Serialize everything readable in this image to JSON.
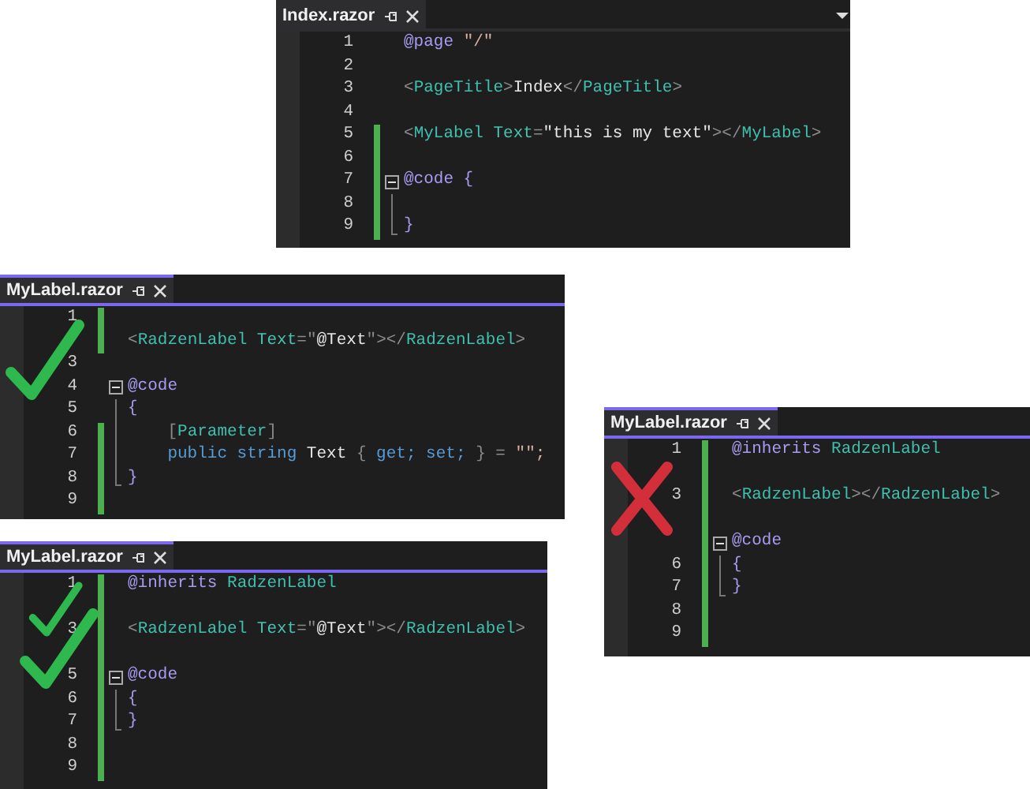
{
  "panels": [
    {
      "tab": {
        "title": "Index.razor",
        "selected": false
      },
      "dropdown": true,
      "lines": [
        {
          "number": "1",
          "changed": false,
          "tokens": [
            {
              "text": "@page",
              "kind": "directive"
            },
            {
              "text": " \"/\"",
              "kind": "string"
            }
          ]
        },
        {
          "number": "2",
          "changed": false
        },
        {
          "number": "3",
          "changed": false,
          "tokens": [
            {
              "text": "<",
              "kind": "punct"
            },
            {
              "text": "PageTitle",
              "kind": "tag"
            },
            {
              "text": ">",
              "kind": "punct"
            },
            {
              "text": "Index",
              "kind": "plain"
            },
            {
              "text": "</",
              "kind": "punct"
            },
            {
              "text": "PageTitle",
              "kind": "tag"
            },
            {
              "text": ">",
              "kind": "punct"
            }
          ]
        },
        {
          "number": "4",
          "changed": false
        },
        {
          "number": "5",
          "changed": true,
          "tokens": [
            {
              "text": "<",
              "kind": "punct"
            },
            {
              "text": "MyLabel",
              "kind": "tag"
            },
            {
              "text": " Text",
              "kind": "attr"
            },
            {
              "text": "=",
              "kind": "punct"
            },
            {
              "text": "\"this is my text\"",
              "kind": "plain"
            },
            {
              "text": "></",
              "kind": "punct"
            },
            {
              "text": "MyLabel",
              "kind": "tag"
            },
            {
              "text": ">",
              "kind": "punct"
            }
          ]
        },
        {
          "number": "6",
          "changed": true
        },
        {
          "number": "7",
          "changed": true,
          "fold_start": true,
          "tokens": [
            {
              "text": "@code {",
              "kind": "directive"
            }
          ]
        },
        {
          "number": "8",
          "changed": true,
          "fold_body": true
        },
        {
          "number": "9",
          "changed": true,
          "fold_end": true,
          "tokens": [
            {
              "text": "}",
              "kind": "directive"
            }
          ]
        }
      ]
    },
    {
      "tab": {
        "title": "MyLabel.razor",
        "selected": true
      },
      "marks": [
        {
          "kind": "check"
        }
      ],
      "lines": [
        {
          "number": "1",
          "changed": true
        },
        {
          "changed": true,
          "tokens": [
            {
              "text": "<",
              "kind": "punct"
            },
            {
              "text": "RadzenLabel",
              "kind": "tag"
            },
            {
              "text": " Text",
              "kind": "attr"
            },
            {
              "text": "=\"",
              "kind": "punct"
            },
            {
              "text": "@Text",
              "kind": "plain"
            },
            {
              "text": "\"></",
              "kind": "punct"
            },
            {
              "text": "RadzenLabel",
              "kind": "tag"
            },
            {
              "text": ">",
              "kind": "punct"
            }
          ]
        },
        {
          "number": "3",
          "changed": false
        },
        {
          "number": "4",
          "changed": false,
          "fold_start": true,
          "tokens": [
            {
              "text": "@code",
              "kind": "directive"
            }
          ]
        },
        {
          "number": "5",
          "changed": false,
          "fold_body": true,
          "tokens": [
            {
              "text": "{",
              "kind": "directive"
            }
          ]
        },
        {
          "number": "6",
          "changed": true,
          "fold_body": true,
          "tokens": [
            {
              "text": "    [",
              "kind": "punct"
            },
            {
              "text": "Parameter",
              "kind": "tag"
            },
            {
              "text": "]",
              "kind": "punct"
            }
          ]
        },
        {
          "number": "7",
          "changed": true,
          "fold_body": true,
          "tokens": [
            {
              "text": "    public string",
              "kind": "keyword"
            },
            {
              "text": " Text ",
              "kind": "plain"
            },
            {
              "text": "{ ",
              "kind": "punct"
            },
            {
              "text": "get; set;",
              "kind": "keyword"
            },
            {
              "text": " } = ",
              "kind": "punct"
            },
            {
              "text": "\"\";",
              "kind": "string"
            }
          ]
        },
        {
          "number": "8",
          "changed": true,
          "fold_end": true,
          "tokens": [
            {
              "text": "}",
              "kind": "directive"
            }
          ]
        },
        {
          "number": "9",
          "changed": true
        }
      ]
    },
    {
      "tab": {
        "title": "MyLabel.razor",
        "selected": true
      },
      "marks": [
        {
          "kind": "check"
        },
        {
          "kind": "check"
        }
      ],
      "lines": [
        {
          "number": "1",
          "changed": true,
          "tokens": [
            {
              "text": "@inherits",
              "kind": "directive"
            },
            {
              "text": " RadzenLabel",
              "kind": "tag"
            }
          ]
        },
        {
          "changed": true
        },
        {
          "number": "3",
          "changed": true,
          "tokens": [
            {
              "text": "<",
              "kind": "punct"
            },
            {
              "text": "RadzenLabel",
              "kind": "tag"
            },
            {
              "text": " Text",
              "kind": "attr"
            },
            {
              "text": "=\"",
              "kind": "punct"
            },
            {
              "text": "@Text",
              "kind": "plain"
            },
            {
              "text": "\"></",
              "kind": "punct"
            },
            {
              "text": "RadzenLabel",
              "kind": "tag"
            },
            {
              "text": ">",
              "kind": "punct"
            }
          ]
        },
        {
          "changed": true
        },
        {
          "number": "5",
          "changed": true,
          "fold_start": true,
          "tokens": [
            {
              "text": "@code",
              "kind": "directive"
            }
          ]
        },
        {
          "number": "6",
          "changed": true,
          "fold_body": true,
          "tokens": [
            {
              "text": "{",
              "kind": "directive"
            }
          ]
        },
        {
          "number": "7",
          "changed": true,
          "fold_end": true,
          "tokens": [
            {
              "text": "}",
              "kind": "directive"
            }
          ]
        },
        {
          "number": "8",
          "changed": true
        },
        {
          "number": "9",
          "changed": true
        }
      ]
    },
    {
      "tab": {
        "title": "MyLabel.razor",
        "selected": true
      },
      "marks": [
        {
          "kind": "cross"
        }
      ],
      "lines": [
        {
          "number": "1",
          "changed": true,
          "tokens": [
            {
              "text": "@inherits",
              "kind": "directive"
            },
            {
              "text": " RadzenLabel",
              "kind": "tag"
            }
          ]
        },
        {
          "changed": true
        },
        {
          "number": "3",
          "changed": true,
          "tokens": [
            {
              "text": "<",
              "kind": "punct"
            },
            {
              "text": "RadzenLabel",
              "kind": "tag"
            },
            {
              "text": "></",
              "kind": "punct"
            },
            {
              "text": "RadzenLabel",
              "kind": "tag"
            },
            {
              "text": ">",
              "kind": "punct"
            }
          ]
        },
        {
          "changed": true
        },
        {
          "changed": true,
          "fold_start": true,
          "tokens": [
            {
              "text": "@code",
              "kind": "directive"
            }
          ]
        },
        {
          "number": "6",
          "changed": true,
          "fold_body": true,
          "tokens": [
            {
              "text": "{",
              "kind": "directive"
            }
          ]
        },
        {
          "number": "7",
          "changed": true,
          "fold_end": true,
          "tokens": [
            {
              "text": "}",
              "kind": "directive"
            }
          ]
        },
        {
          "number": "8",
          "changed": true
        },
        {
          "number": "9",
          "changed": true
        }
      ]
    }
  ]
}
